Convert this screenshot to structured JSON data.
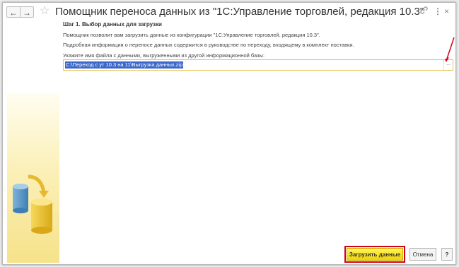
{
  "window": {
    "title": "Помощник переноса данных из \"1С:Управление торговлей, редакция 10.3\"",
    "nav_back": "←",
    "nav_forward": "→",
    "favorite": "☆",
    "link_icon": "🔗",
    "more_icon": "⋮",
    "close_icon": "×"
  },
  "step": {
    "heading": "Шаг 1.  Выбор данных для загрузки",
    "description": "Помощник позволит вам загрузить данные из конфигурации \"1С:Управление торговлей, редакция 10.3\".",
    "info": "Подробная информация о переносе данных содержится в руководстве по переходу, входящему в комплект поставки.",
    "file_prompt": "Укажите имя файла с данными, выгруженными из другой информационной базы:"
  },
  "file": {
    "value": "C:\\Переход с ут 10.3 на 11\\Выгрузка данных.zip",
    "browse_label": "..."
  },
  "buttons": {
    "load": "Загрузить данные",
    "cancel": "Отмена",
    "help": "?"
  },
  "colors": {
    "accent_yellow": "#f5e000",
    "highlight_red": "#d0021b",
    "selection_blue": "#3b67c9"
  }
}
